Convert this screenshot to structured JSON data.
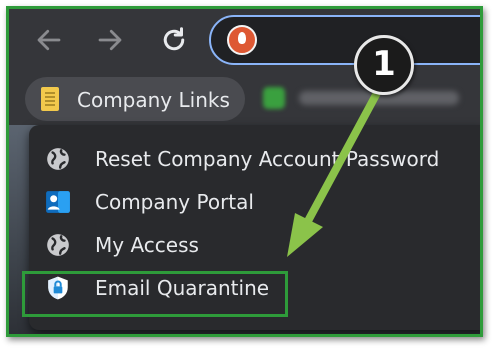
{
  "bookmarks_bar": {
    "folder_label": "Company Links"
  },
  "menu": {
    "items": [
      {
        "label": "Reset Company Account Password",
        "icon": "globe-icon"
      },
      {
        "label": "Company Portal",
        "icon": "company-portal-icon"
      },
      {
        "label": "My Access",
        "icon": "globe-icon"
      },
      {
        "label": "Email Quarantine",
        "icon": "shield-lock-icon"
      }
    ]
  },
  "annotation": {
    "step_number": "1"
  },
  "colors": {
    "highlight": "#2e9b3a",
    "omnibox_border": "#8ab4f8",
    "menu_bg": "#292a2d",
    "arrow": "#8bc34a"
  }
}
